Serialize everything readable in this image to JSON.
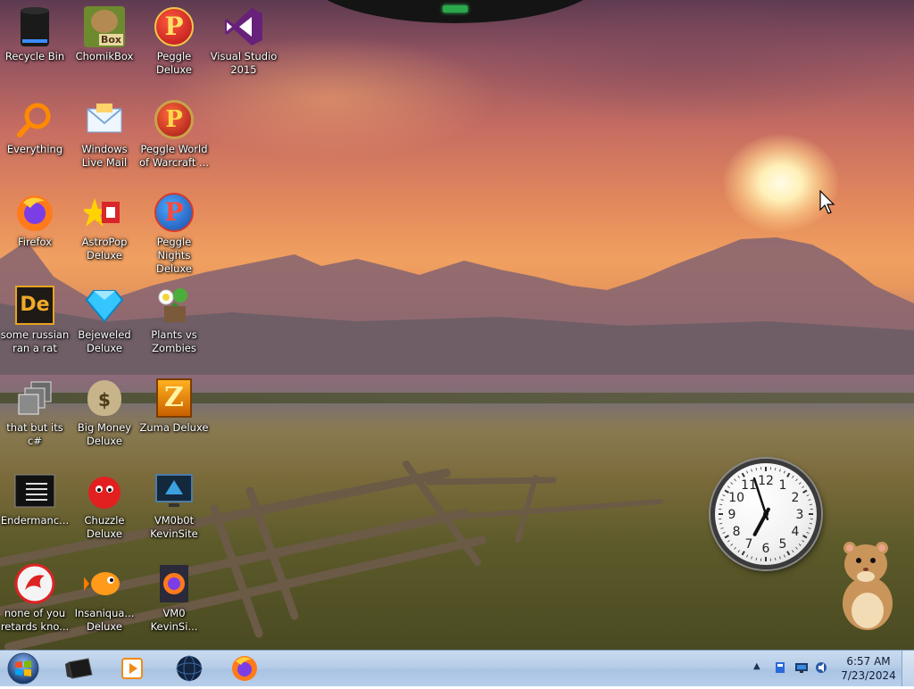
{
  "desktop": {
    "icons": [
      {
        "id": "recycle-bin",
        "label": "Recycle Bin",
        "icon": "recycle-bin-icon"
      },
      {
        "id": "chomikbox",
        "label": "ChomikBox",
        "icon": "chomikbox-icon",
        "badge": "Box"
      },
      {
        "id": "peggle-deluxe",
        "label": "Peggle Deluxe",
        "icon": "peggle-icon",
        "glyph": "P"
      },
      {
        "id": "visual-studio",
        "label": "Visual Studio 2015",
        "icon": "visual-studio-icon"
      },
      {
        "id": "everything",
        "label": "Everything",
        "icon": "magnifier-icon"
      },
      {
        "id": "windows-live-mail",
        "label": "Windows Live Mail",
        "icon": "mail-icon"
      },
      {
        "id": "peggle-wow",
        "label": "Peggle World of Warcraft ...",
        "icon": "peggle-icon",
        "glyph": "P"
      },
      {
        "id": "firefox",
        "label": "Firefox",
        "icon": "firefox-icon"
      },
      {
        "id": "astropop",
        "label": "AstroPop Deluxe",
        "icon": "astropop-icon"
      },
      {
        "id": "peggle-nights",
        "label": "Peggle Nights Deluxe",
        "icon": "peggle-icon",
        "glyph": "P"
      },
      {
        "id": "russian-rat",
        "label": "some russian ran a rat",
        "icon": "de-icon",
        "glyph": "De"
      },
      {
        "id": "bejeweled",
        "label": "Bejeweled Deluxe",
        "icon": "gem-icon"
      },
      {
        "id": "pvz",
        "label": "Plants vs Zombies",
        "icon": "plant-icon"
      },
      {
        "id": "that-but-csharp",
        "label": "that but its c#",
        "icon": "windows-stack-icon"
      },
      {
        "id": "big-money",
        "label": "Big Money Deluxe",
        "icon": "money-bag-icon",
        "glyph": "$"
      },
      {
        "id": "zuma",
        "label": "Zuma Deluxe",
        "icon": "zuma-icon",
        "glyph": "Z"
      },
      {
        "id": "endermancer",
        "label": "Endermanc...",
        "icon": "console-icon"
      },
      {
        "id": "chuzzle",
        "label": "Chuzzle Deluxe",
        "icon": "chuzzle-icon"
      },
      {
        "id": "vm0b0t",
        "label": "VM0b0t KevinSite",
        "icon": "vm-icon"
      },
      {
        "id": "none-of-you",
        "label": "none of you retards kno...",
        "icon": "red-app-icon"
      },
      {
        "id": "insaniquarium",
        "label": "Insaniqua... Deluxe",
        "icon": "fish-icon"
      },
      {
        "id": "vm0-kevinsi",
        "label": "VM0 KevinSi...",
        "icon": "firefox-doc-icon"
      }
    ]
  },
  "taskbar": {
    "start_label": "Start",
    "pinned": [
      {
        "name": "taskbar-app-black-box",
        "icon": "black-box-icon"
      },
      {
        "name": "taskbar-media-player",
        "icon": "media-player-icon"
      },
      {
        "name": "taskbar-globe",
        "icon": "globe-icon"
      },
      {
        "name": "taskbar-firefox",
        "icon": "firefox-icon"
      }
    ],
    "tray": {
      "overflow": "▲",
      "time": "6:57 AM",
      "date": "7/23/2024"
    }
  },
  "gadgets": {
    "clock": {
      "type": "analog-clock",
      "hour": 6,
      "minute": 57,
      "numerals": [
        "12",
        "1",
        "2",
        "3",
        "4",
        "5",
        "6",
        "7",
        "8",
        "9",
        "10",
        "11"
      ]
    }
  },
  "colors": {
    "taskbar": "#b6cde8",
    "icon_label": "#ffffff"
  }
}
